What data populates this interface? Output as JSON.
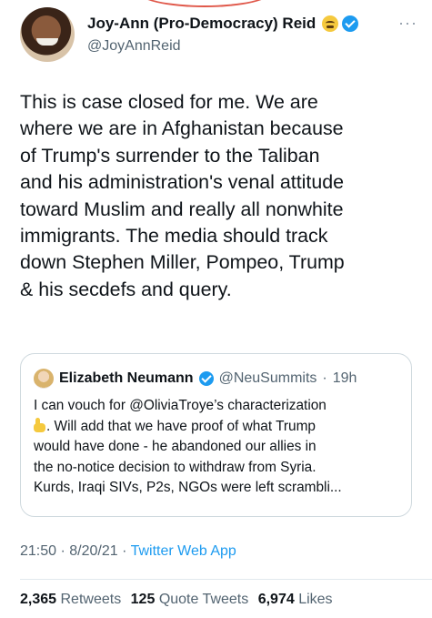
{
  "author": {
    "name": "Joy-Ann (Pro-Democracy) Reid",
    "handle": "@JoyAnnReid"
  },
  "tweet": {
    "lines": [
      "This is case closed for me. We are",
      "where we are in Afghanistan because",
      "of Trump's surrender to the Taliban",
      "and his administration's venal attitude",
      "toward Muslim and really all nonwhite",
      "immigrants. The media should track",
      "down Stephen Miller, Pompeo, Trump",
      "& his secdefs and query."
    ]
  },
  "quote": {
    "name": "Elizabeth Neumann",
    "handle": "@NeuSummits",
    "separator": "·",
    "time": "19h",
    "line1": "I can vouch for @OliviaTroye’s characterization",
    "line2": ". Will add that we have proof of what Trump",
    "line3": "would have done - he abandoned our allies in",
    "line4": "the no-notice decision to withdraw from Syria.",
    "line5": "Kurds, Iraqi SIVs, P2s, NGOs were left scrambli..."
  },
  "meta": {
    "time": "21:50",
    "sep1": "·",
    "date": "8/20/21",
    "sep2": "·",
    "app": "Twitter Web App"
  },
  "stats": {
    "retweets_count": "2,365",
    "retweets_label": "Retweets",
    "quotes_count": "125",
    "quotes_label": "Quote Tweets",
    "likes_count": "6,974",
    "likes_label": "Likes"
  },
  "icons": {
    "more": "more-options-icon",
    "verified": "verified-badge-icon",
    "emoji": "grimacing-face-icon",
    "point": "pointing-down-icon"
  },
  "colors": {
    "accent": "#1d9bf0",
    "muted": "#536471",
    "text": "#0f1419"
  }
}
